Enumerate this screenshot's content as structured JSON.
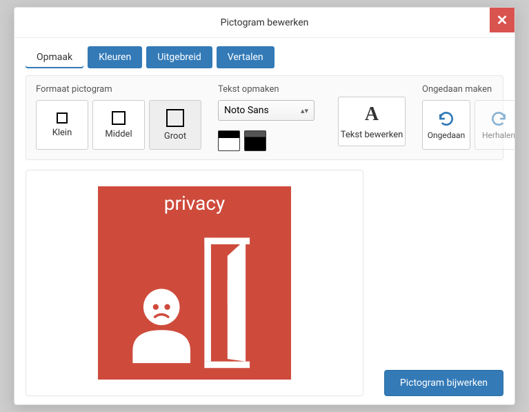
{
  "header": {
    "title": "Pictogram bewerken"
  },
  "tabs": [
    "Opmaak",
    "Kleuren",
    "Uitgebreid",
    "Vertalen"
  ],
  "activeTab": 0,
  "size": {
    "label": "Formaat pictogram",
    "options": [
      "Klein",
      "Middel",
      "Groot"
    ],
    "selected": 2
  },
  "textFormat": {
    "label": "Tekst opmaken",
    "font": "Noto Sans",
    "editLabel": "Tekst bewerken"
  },
  "undo": {
    "label": "Ongedaan maken",
    "undoLabel": "Ongedaan",
    "redoLabel": "Herhalen"
  },
  "pictogram": {
    "caption": "privacy",
    "bgColor": "#ce4b3c"
  },
  "footer": {
    "submit": "Pictogram bijwerken"
  }
}
